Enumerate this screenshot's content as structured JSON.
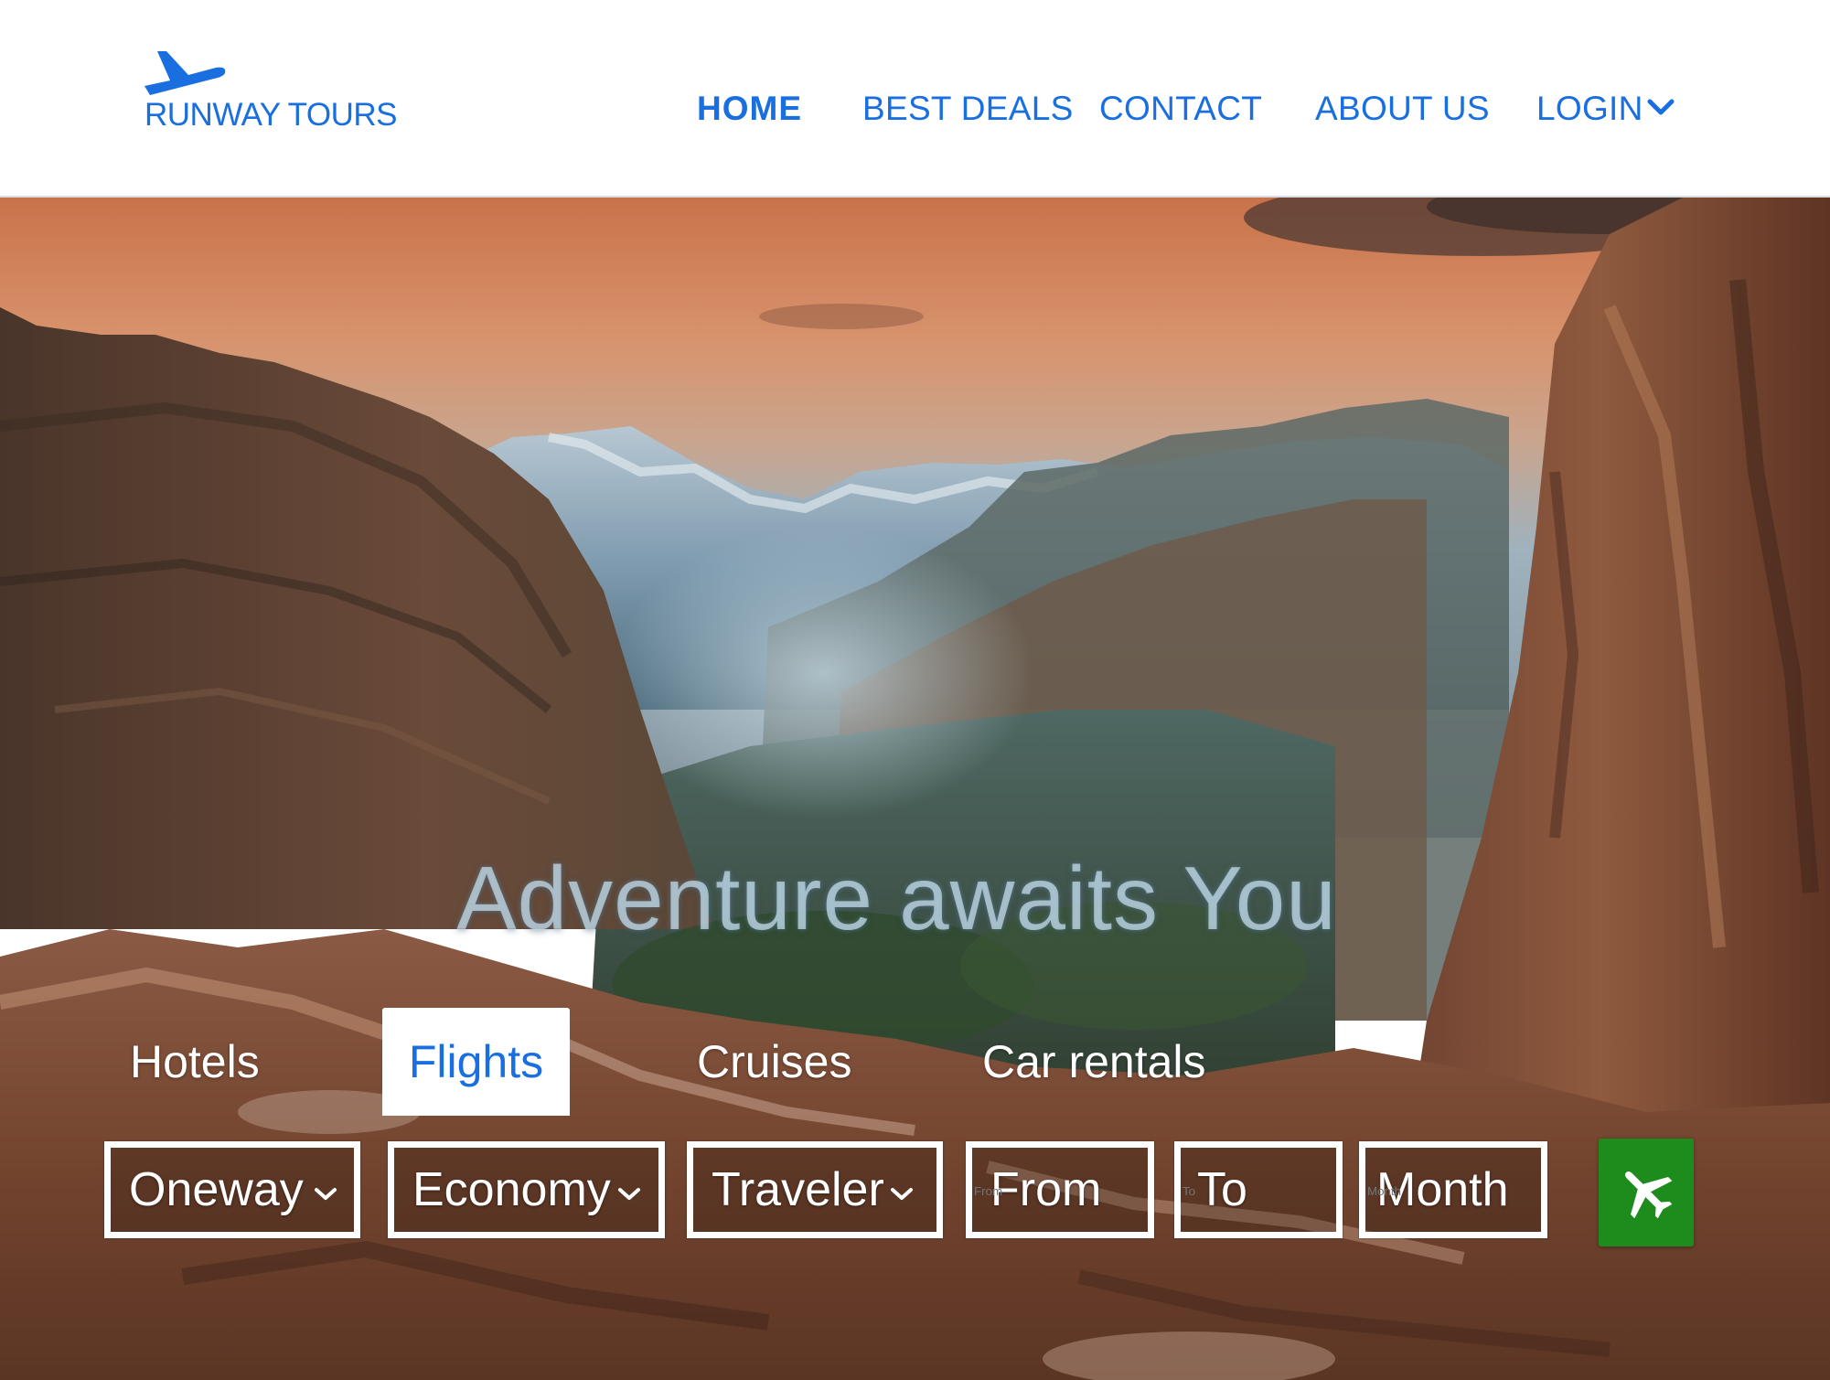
{
  "brand": {
    "name": "RUNWAY TOURS",
    "logo_icon": "airplane-takeoff-icon",
    "color": "#1a6fe0"
  },
  "nav": {
    "home": "HOME",
    "best_deals": "BEST DEALS",
    "contact": "CONTACT",
    "about_us": "ABOUT US",
    "login": "LOGIN",
    "login_icon": "chevron-down-icon",
    "active": "HOME"
  },
  "hero": {
    "headline": "Adventure awaits You"
  },
  "tabs": {
    "hotels": "Hotels",
    "flights": "Flights",
    "cruises": "Cruises",
    "car_rentals": "Car rentals",
    "active": "Flights"
  },
  "search": {
    "trip_type": "Oneway",
    "cabin_class": "Economy",
    "travelers": "Traveler",
    "from_placeholder": "From",
    "to_placeholder": "To",
    "month_placeholder": "Month",
    "submit_icon": "airplane-icon",
    "submit_color": "#1d8c1d"
  }
}
